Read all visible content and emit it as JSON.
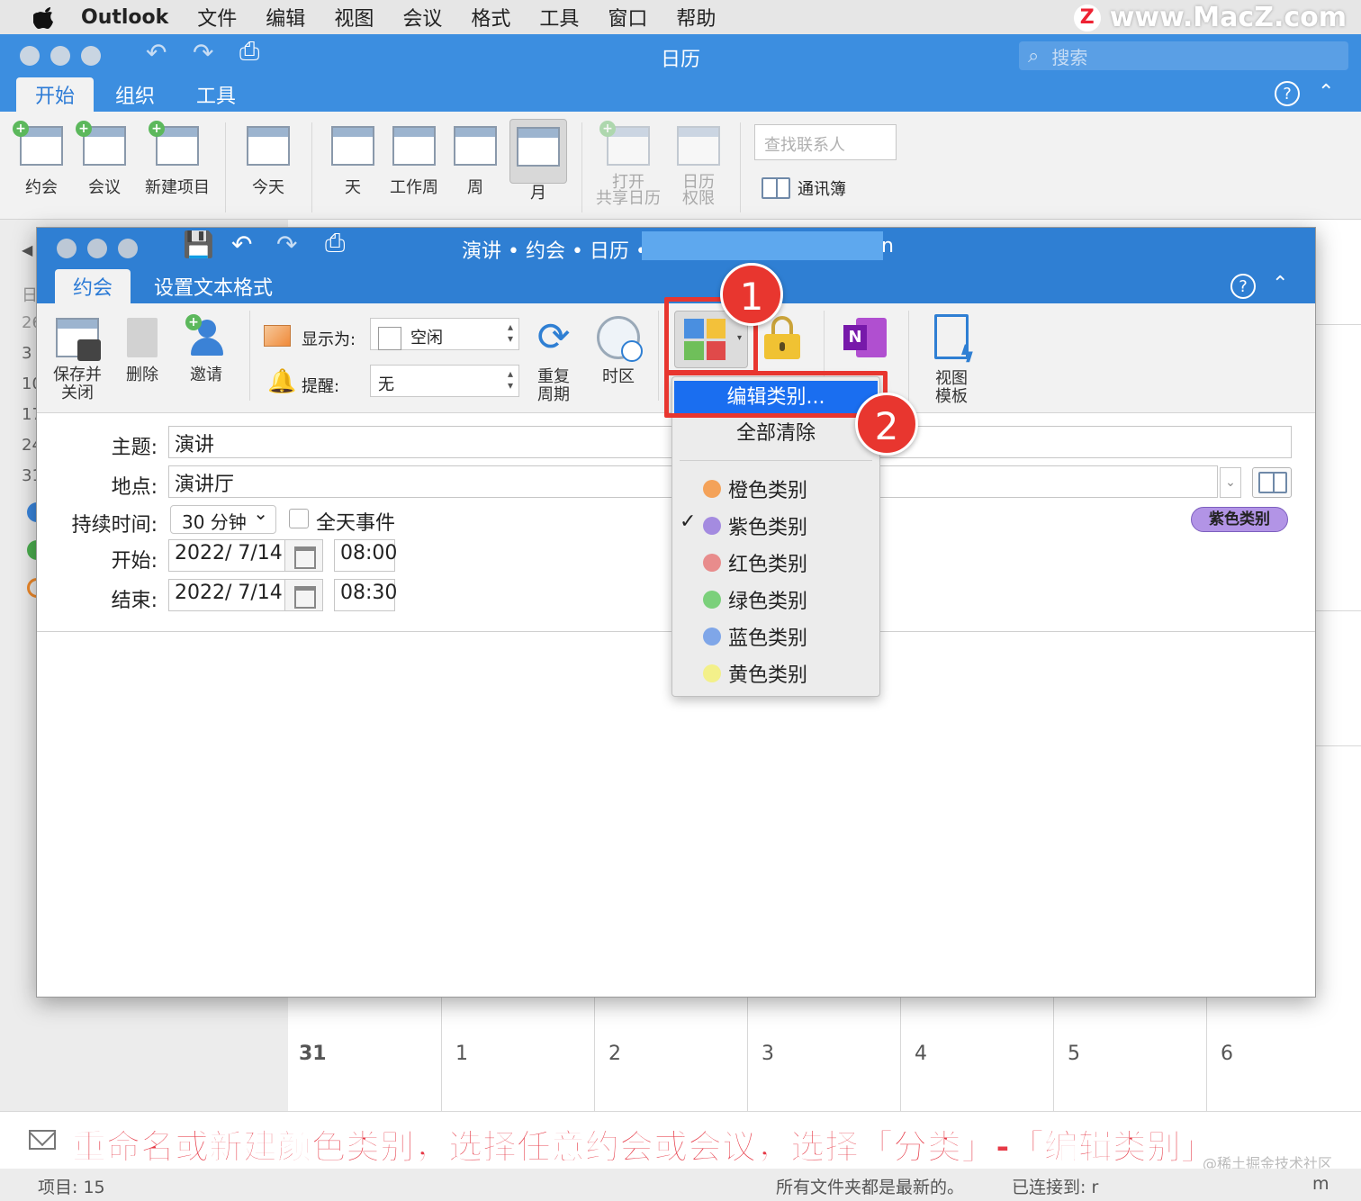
{
  "menubar": {
    "app": "Outlook",
    "items": [
      "文件",
      "编辑",
      "视图",
      "会议",
      "格式",
      "工具",
      "窗口",
      "帮助"
    ],
    "watermark": "www.MacZ.com"
  },
  "main_window": {
    "title": "日历",
    "search_placeholder": "搜索",
    "tabs": [
      "开始",
      "组织",
      "工具"
    ],
    "ribbon": {
      "appointment": "约会",
      "meeting": "会议",
      "new_item": "新建项目",
      "today": "今天",
      "day": "天",
      "work_week": "工作周",
      "week": "周",
      "month": "月",
      "open_shared_1": "打开",
      "open_shared_2": "共享日历",
      "permissions_1": "日历",
      "permissions_2": "权限",
      "find_contact_placeholder": "查找联系人",
      "address_book": "通讯簿"
    },
    "sidebar_numbers": [
      "日",
      "26",
      "3",
      "10",
      "17",
      "24",
      "31"
    ],
    "grid_days": [
      "31",
      "1",
      "2",
      "3",
      "4",
      "5",
      "6"
    ]
  },
  "appointment_window": {
    "title": "演讲 • 约会 • 日历 •",
    "title_suffix": "n",
    "tabs": [
      "约会",
      "设置文本格式"
    ],
    "ribbon": {
      "save_close_1": "保存并",
      "save_close_2": "关闭",
      "delete": "删除",
      "invite": "邀请",
      "show_as_label": "显示为:",
      "show_as_value": "空闲",
      "reminder_label": "提醒:",
      "reminder_value": "无",
      "recurrence_1": "重复",
      "recurrence_2": "周期",
      "timezone": "时区",
      "view_templates_1": "视图",
      "view_templates_2": "模板"
    },
    "form": {
      "subject_label": "主题:",
      "subject_value": "演讲",
      "location_label": "地点:",
      "location_value": "演讲厅",
      "duration_label": "持续时间:",
      "duration_value": "30 分钟",
      "all_day_label": "全天事件",
      "start_label": "开始:",
      "start_date": "2022/  7/14",
      "start_time": "08:00",
      "end_label": "结束:",
      "end_date": "2022/  7/14",
      "end_time": "08:30",
      "category_badge": "紫色类别"
    }
  },
  "category_menu": {
    "edit": "编辑类别...",
    "clear_all": "全部清除",
    "checkmark": "✓",
    "items": [
      {
        "label": "橙色类别",
        "color": "#f4a259"
      },
      {
        "label": "紫色类别",
        "color": "#a48be0"
      },
      {
        "label": "红色类别",
        "color": "#e88c8c"
      },
      {
        "label": "绿色类别",
        "color": "#7bd07b"
      },
      {
        "label": "蓝色类别",
        "color": "#7fa6e8"
      },
      {
        "label": "黄色类别",
        "color": "#f3f08a"
      }
    ]
  },
  "callouts": {
    "step1": "1",
    "step2": "2"
  },
  "banner": {
    "text": "重命名或新建颜色类别，选择任意约会或会议，选择「分类」-「编辑类别」",
    "watermark": "@稀土掘金技术社区"
  },
  "status": {
    "items": "项目: 15",
    "up_to_date": "所有文件夹都是最新的。",
    "connected": "已连接到: r",
    "trail": "m"
  },
  "colors": {
    "title_blue": "#3c8ee0",
    "appt_blue": "#2f7fd3",
    "highlight": "#1a6ef0",
    "callout_red": "#e8362f"
  }
}
